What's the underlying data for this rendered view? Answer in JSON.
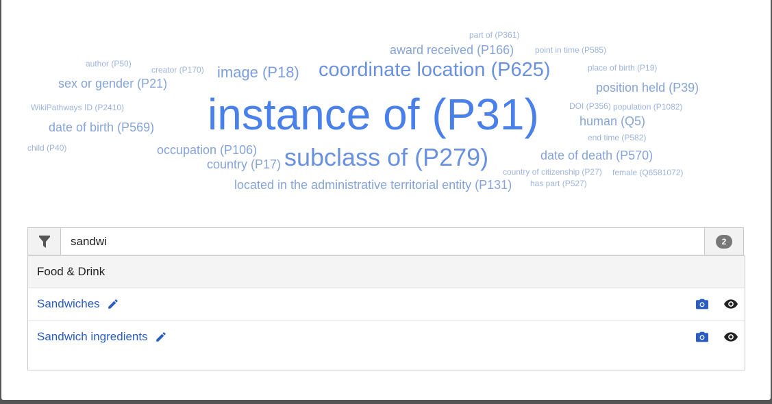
{
  "word_cloud": {
    "words": [
      {
        "text": "part of (P361)",
        "size": 12,
        "color": "#9db4dc"
      },
      {
        "text": "award received (P166)",
        "size": 18,
        "color": "#86a4d8"
      },
      {
        "text": "point in time (P585)",
        "size": 12,
        "color": "#9db4dc"
      },
      {
        "text": "author (P50)",
        "size": 12,
        "color": "#9db4dc"
      },
      {
        "text": "creator (P170)",
        "size": 12,
        "color": "#9db4dc"
      },
      {
        "text": "image (P18)",
        "size": 22,
        "color": "#7b9de0"
      },
      {
        "text": "coordinate location (P625)",
        "size": 29,
        "color": "#6a91e0"
      },
      {
        "text": "place of birth (P19)",
        "size": 12,
        "color": "#9db4dc"
      },
      {
        "text": "sex or gender (P21)",
        "size": 18,
        "color": "#86a4d8"
      },
      {
        "text": "position held (P39)",
        "size": 18,
        "color": "#86a4d8"
      },
      {
        "text": "WikiPathways ID (P2410)",
        "size": 12,
        "color": "#9db4dc"
      },
      {
        "text": "instance of (P31)",
        "size": 64,
        "color": "#4a80ea"
      },
      {
        "text": "DOI (P356)",
        "size": 12,
        "color": "#9db4dc"
      },
      {
        "text": "population (P1082)",
        "size": 12,
        "color": "#9db4dc"
      },
      {
        "text": "date of birth (P569)",
        "size": 18,
        "color": "#86a4d8"
      },
      {
        "text": "human (Q5)",
        "size": 18,
        "color": "#86a4d8"
      },
      {
        "text": "end time (P582)",
        "size": 12,
        "color": "#9db4dc"
      },
      {
        "text": "child (P40)",
        "size": 12,
        "color": "#9db4dc"
      },
      {
        "text": "occupation (P106)",
        "size": 18,
        "color": "#86a4d8"
      },
      {
        "text": "subclass of (P279)",
        "size": 36,
        "color": "#6a91e0"
      },
      {
        "text": "date of death (P570)",
        "size": 18,
        "color": "#86a4d8"
      },
      {
        "text": "country (P17)",
        "size": 18,
        "color": "#86a4d8"
      },
      {
        "text": "country of citizenship (P27)",
        "size": 12,
        "color": "#9db4dc"
      },
      {
        "text": "female (Q6581072)",
        "size": 12,
        "color": "#9db4dc"
      },
      {
        "text": "located in the administrative territorial entity (P131)",
        "size": 18,
        "color": "#86a4d8"
      },
      {
        "text": "has part (P527)",
        "size": 12,
        "color": "#9db4dc"
      }
    ]
  },
  "filter": {
    "icon": "filter-icon",
    "value": "sandwi",
    "count": "2"
  },
  "results": {
    "group_label": "Food & Drink",
    "items": [
      {
        "label": "Sandwiches"
      },
      {
        "label": "Sandwich ingredients"
      }
    ]
  },
  "colors": {
    "link": "#2a5dbf",
    "accent": "#4a80ea"
  }
}
